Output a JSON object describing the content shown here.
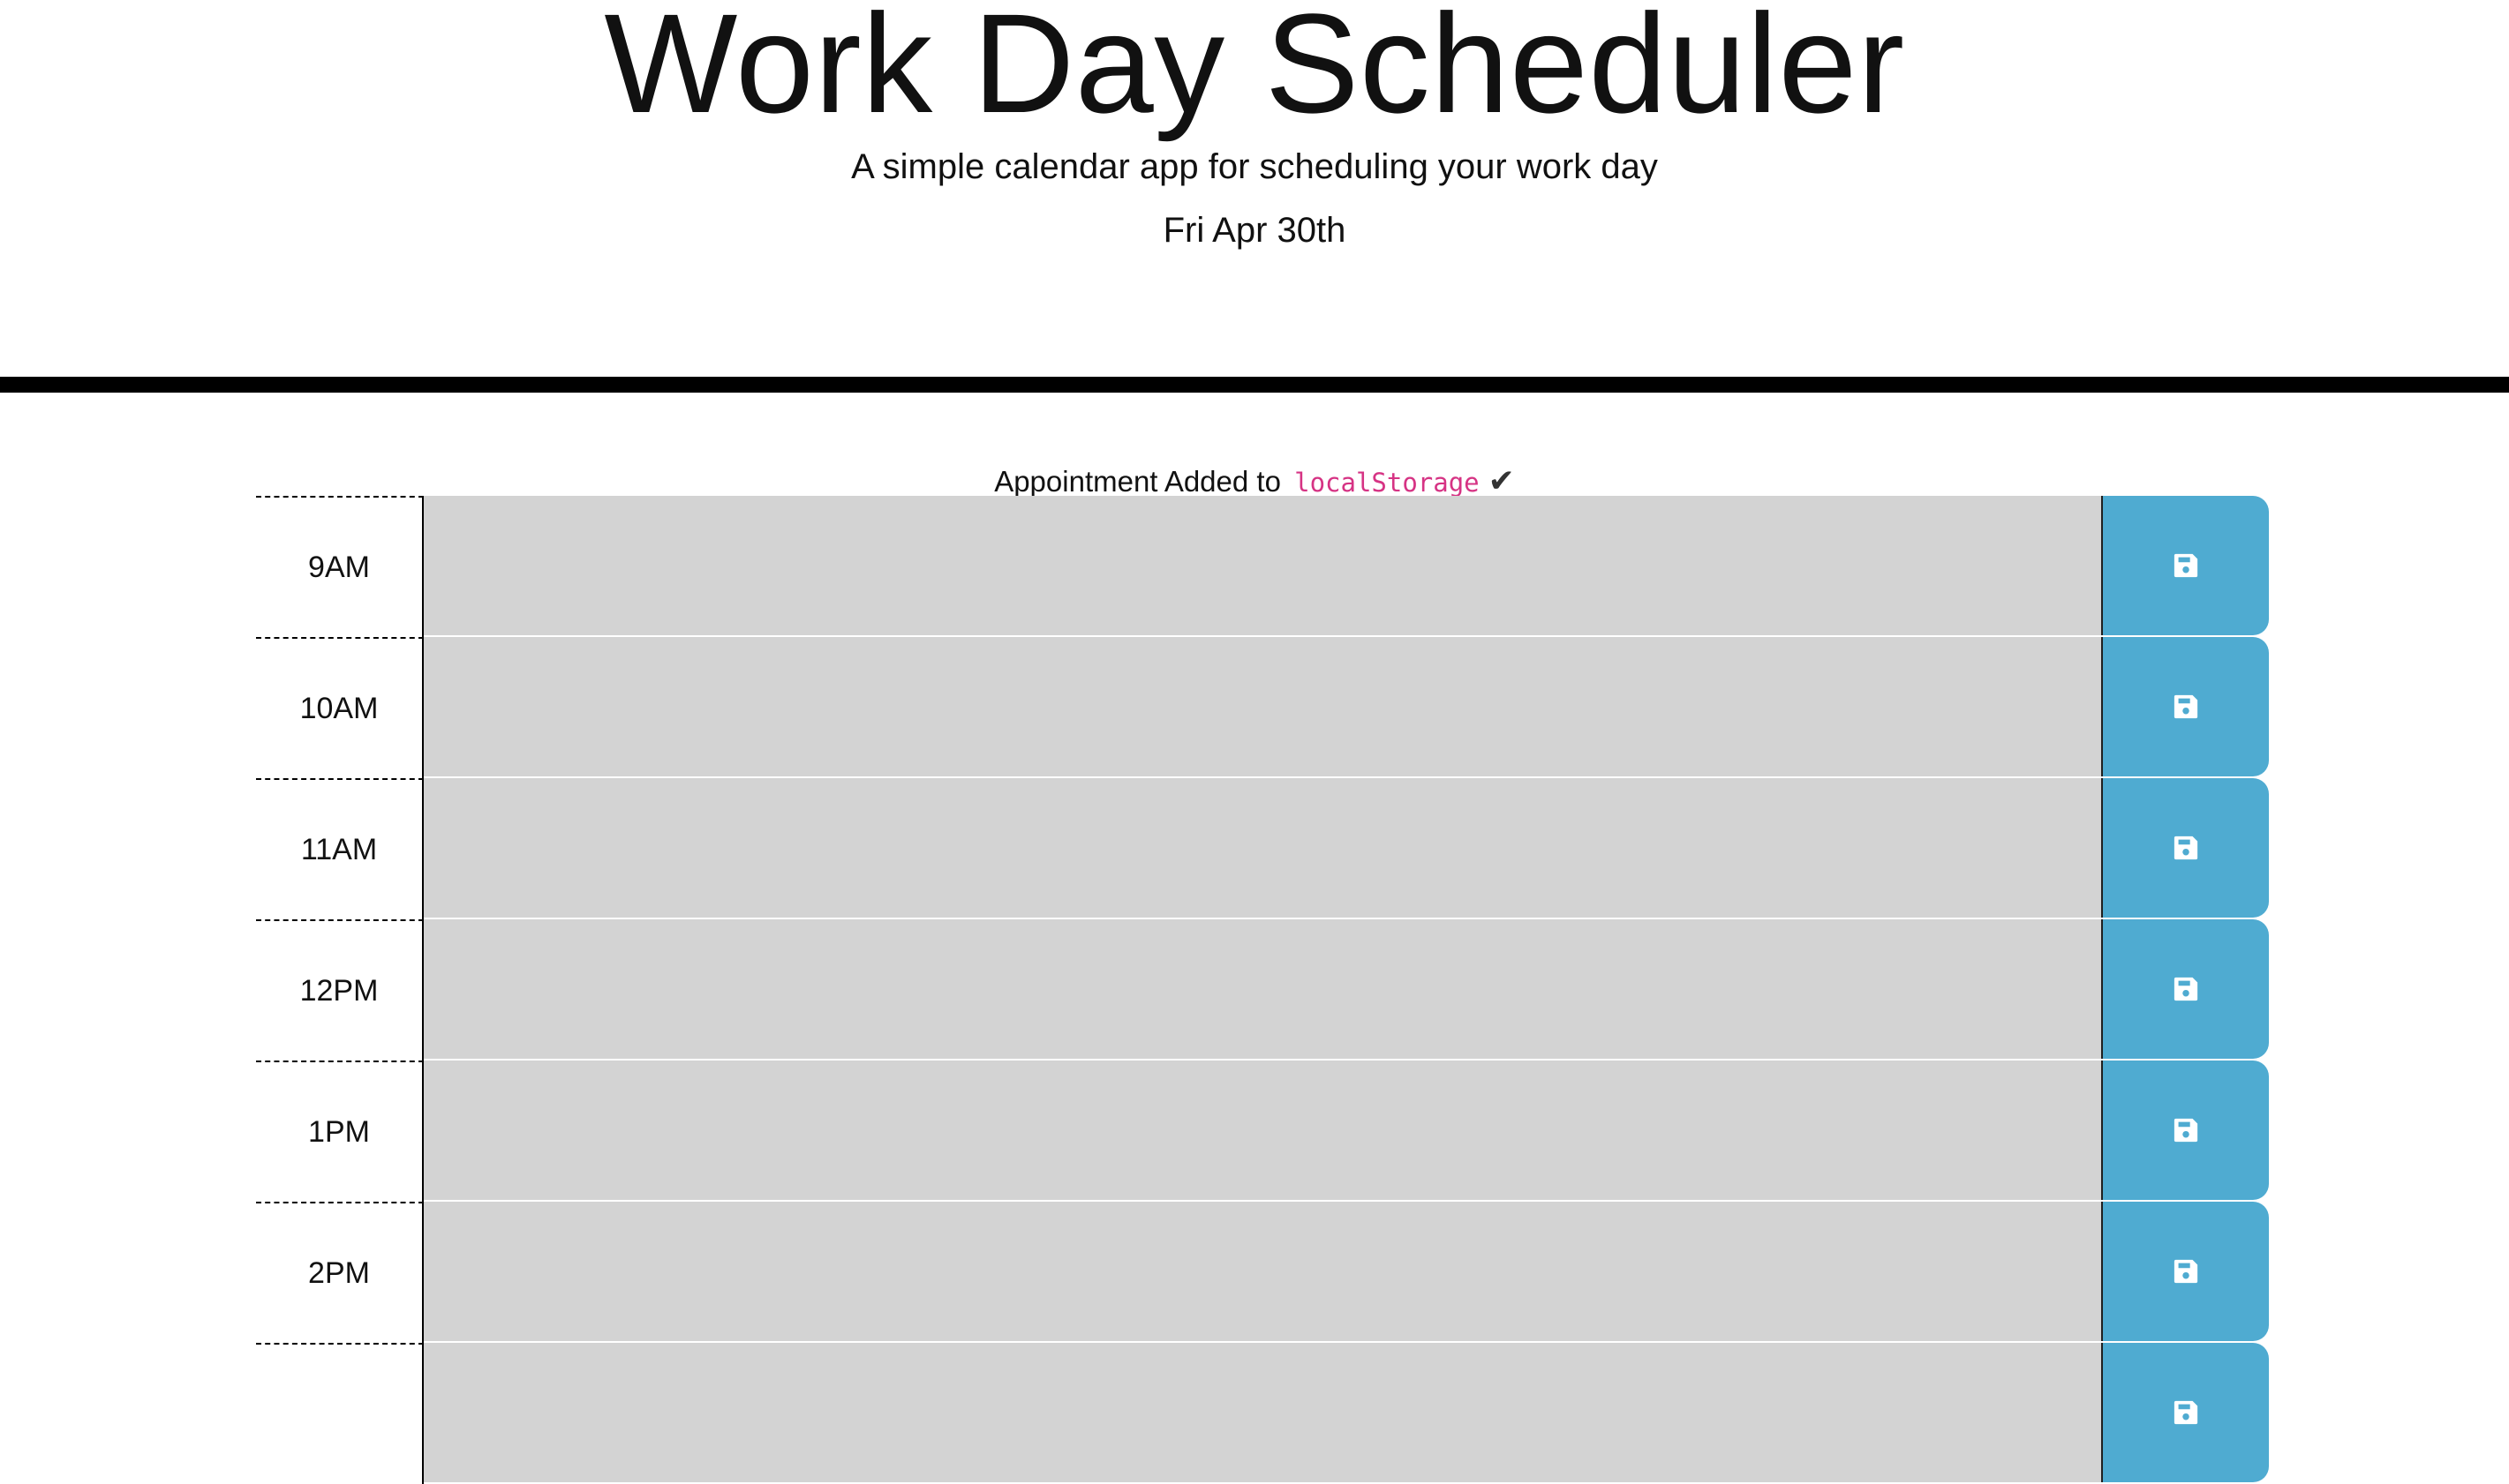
{
  "header": {
    "title": "Work Day Scheduler",
    "subtitle": "A simple calendar app for scheduling your work day",
    "current_day": "Fri Apr 30th"
  },
  "notice": {
    "prefix": "Appointment Added to",
    "code": "localStorage",
    "check": "✔"
  },
  "timeblocks": [
    {
      "hour": "9AM",
      "description": ""
    },
    {
      "hour": "10AM",
      "description": ""
    },
    {
      "hour": "11AM",
      "description": ""
    },
    {
      "hour": "12PM",
      "description": ""
    },
    {
      "hour": "1PM",
      "description": ""
    },
    {
      "hour": "2PM",
      "description": ""
    },
    {
      "hour": "",
      "description": ""
    }
  ],
  "save_icon": "floppy-disk-icon",
  "colors": {
    "save_button": "#4fabd1",
    "description_bg": "#d3d3d3",
    "code_text": "#d63384",
    "divider": "#000000"
  }
}
